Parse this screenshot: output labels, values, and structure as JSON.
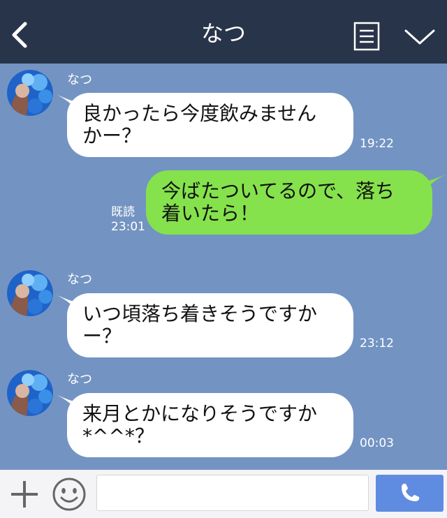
{
  "header": {
    "title": "なつ",
    "back_icon": "chevron-left-icon",
    "menu_icon": "list-icon",
    "collapse_icon": "chevron-down-icon"
  },
  "messages": [
    {
      "sender": "なつ",
      "text_line1": "良かったら今度飲みません",
      "text_line2": "かー？",
      "time": "19:22",
      "direction": "incoming"
    },
    {
      "text_line1": "今ばたついてるので、落ち",
      "text_line2": "着いたら！",
      "read_label": "既読",
      "time": "23:01",
      "direction": "outgoing"
    },
    {
      "sender": "なつ",
      "text_line1": "いつ頃落ち着きそうですか",
      "text_line2": "ー？",
      "time": "23:12",
      "direction": "incoming"
    },
    {
      "sender": "なつ",
      "text_line1": "来月とかになりそうですか",
      "text_line2": "*^^*？",
      "time": "00:03",
      "direction": "incoming"
    }
  ],
  "input_bar": {
    "plus_icon": "plus-icon",
    "emoji_icon": "smiley-icon",
    "message_value": "",
    "call_icon": "phone-icon"
  },
  "colors": {
    "header_bg": "#283449",
    "chat_bg": "#7394c2",
    "incoming_bubble": "#ffffff",
    "outgoing_bubble": "#85e24c",
    "call_button": "#5f8ce0"
  }
}
